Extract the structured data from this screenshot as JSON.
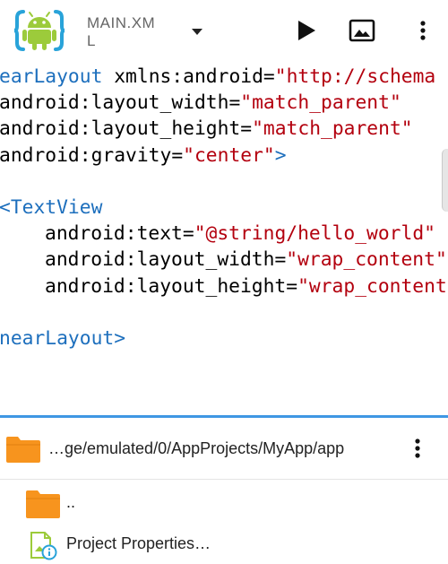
{
  "toolbar": {
    "file_title": "MAIN.XML",
    "icons": {
      "logo": "android-xml-logo-icon",
      "dropdown": "dropdown-arrow-icon",
      "run": "play-icon",
      "design": "image-preview-icon",
      "more": "more-vert-icon"
    }
  },
  "editor": {
    "lines": [
      {
        "indent": "",
        "parts": [
          {
            "t": "tag",
            "v": "earLayout"
          },
          {
            "t": "attr",
            "v": " xmlns:android"
          },
          {
            "t": "eq",
            "v": "="
          },
          {
            "t": "val",
            "v": "\"http://schema"
          }
        ]
      },
      {
        "indent": "",
        "parts": [
          {
            "t": "attr",
            "v": "android:layout_width"
          },
          {
            "t": "eq",
            "v": "="
          },
          {
            "t": "val",
            "v": "\"match_parent\""
          }
        ]
      },
      {
        "indent": "",
        "parts": [
          {
            "t": "attr",
            "v": "android:layout_height"
          },
          {
            "t": "eq",
            "v": "="
          },
          {
            "t": "val",
            "v": "\"match_parent\""
          }
        ]
      },
      {
        "indent": "",
        "parts": [
          {
            "t": "attr",
            "v": "android:gravity"
          },
          {
            "t": "eq",
            "v": "="
          },
          {
            "t": "val",
            "v": "\"center\""
          },
          {
            "t": "tag",
            "v": ">"
          }
        ]
      },
      {
        "indent": "",
        "parts": []
      },
      {
        "indent": "",
        "parts": [
          {
            "t": "tag",
            "v": "<TextView"
          }
        ]
      },
      {
        "indent": "    ",
        "parts": [
          {
            "t": "attr",
            "v": "android:text"
          },
          {
            "t": "eq",
            "v": "="
          },
          {
            "t": "val",
            "v": "\"@string/hello_world\""
          }
        ]
      },
      {
        "indent": "    ",
        "parts": [
          {
            "t": "attr",
            "v": "android:layout_width"
          },
          {
            "t": "eq",
            "v": "="
          },
          {
            "t": "val",
            "v": "\"wrap_content\""
          }
        ]
      },
      {
        "indent": "    ",
        "parts": [
          {
            "t": "attr",
            "v": "android:layout_height"
          },
          {
            "t": "eq",
            "v": "="
          },
          {
            "t": "val",
            "v": "\"wrap_content\""
          }
        ]
      },
      {
        "indent": "",
        "parts": []
      },
      {
        "indent": "",
        "parts": [
          {
            "t": "tag",
            "v": "nearLayout>"
          }
        ]
      }
    ]
  },
  "file_browser": {
    "path": "…ge/emulated/0/AppProjects/MyApp/app",
    "items": [
      {
        "label": "..",
        "icon": "folder-icon"
      },
      {
        "label": "Project Properties…",
        "icon": "project-properties-icon"
      }
    ],
    "accent_color": "#3f97e3",
    "folder_color": "#f7941e"
  }
}
